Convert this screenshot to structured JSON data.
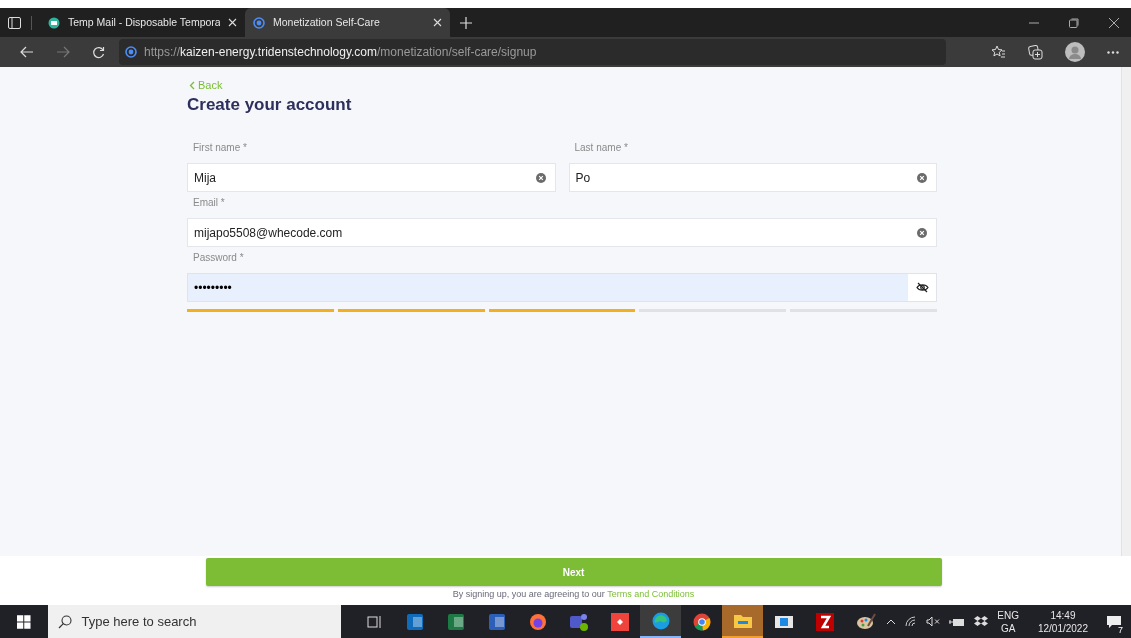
{
  "browser": {
    "tabs": [
      {
        "title": "Temp Mail - Disposable Tempora",
        "selected": false
      },
      {
        "title": "Monetization Self-Care",
        "selected": true
      }
    ],
    "address": {
      "scheme": "https://",
      "host": "kaizen-energy.tridenstechnology.com",
      "path": "/monetization/self-care/signup"
    }
  },
  "page": {
    "back": "Back",
    "title": "Create your account",
    "fields": [
      {
        "label": "First name *",
        "value": "Mija",
        "focused": false,
        "kind": "text"
      },
      {
        "label": "Last name *",
        "value": "Po",
        "focused": false,
        "kind": "text"
      },
      {
        "label": "Email *",
        "value": "mijapo5508@whecode.com",
        "focused": false,
        "kind": "text"
      },
      {
        "label": "Password *",
        "value": "•••••••••",
        "focused": true,
        "kind": "password"
      }
    ],
    "strength": {
      "level": 0.6
    },
    "next_button": "Next",
    "terms": {
      "text": "By signing up, you are agreeing to our",
      "link": "Terms and Conditions"
    }
  },
  "taskbar": {
    "search_placeholder": "Type here to search",
    "apps": [
      {
        "kind": "taskview",
        "selected": false,
        "flashing": false
      },
      {
        "kind": "outlook",
        "selected": false,
        "flashing": false
      },
      {
        "kind": "excel",
        "selected": false,
        "flashing": false
      },
      {
        "kind": "word",
        "selected": false,
        "flashing": false
      },
      {
        "kind": "firefox",
        "selected": false,
        "flashing": false
      },
      {
        "kind": "teams",
        "selected": false,
        "flashing": false
      },
      {
        "kind": "anydesk",
        "selected": false,
        "flashing": false
      },
      {
        "kind": "edge",
        "selected": true,
        "flashing": false
      },
      {
        "kind": "chrome",
        "selected": false,
        "flashing": false
      },
      {
        "kind": "explorer",
        "selected": false,
        "flashing": true
      },
      {
        "kind": "window",
        "selected": false,
        "flashing": false
      },
      {
        "kind": "filezilla",
        "selected": false,
        "flashing": false
      },
      {
        "kind": "paint",
        "selected": false,
        "flashing": false
      }
    ],
    "language": "ENG",
    "layout": "GA",
    "time": "14:49",
    "date": "12/01/2022",
    "notifications": "7"
  }
}
